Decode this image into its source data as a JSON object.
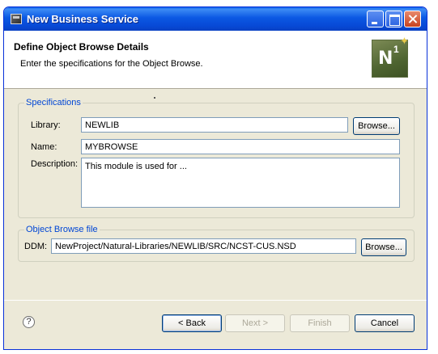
{
  "window": {
    "title": "New Business Service"
  },
  "header": {
    "title": "Define Object Browse Details",
    "description": "Enter the specifications for the Object Browse.",
    "logo_text_n": "N",
    "logo_text_1": "1"
  },
  "specifications": {
    "legend": "Specifications",
    "library_label": "Library:",
    "library_value": "NEWLIB",
    "browse_label": "Browse...",
    "name_label": "Name:",
    "name_value": "MYBROWSE",
    "description_label": "Description:",
    "description_value": "This module is used for ..."
  },
  "object_browse_file": {
    "legend": "Object Browse file",
    "ddm_label": "DDM:",
    "ddm_value": "NewProject/Natural-Libraries/NEWLIB/SRC/NCST-CUS.NSD",
    "browse_label": "Browse..."
  },
  "footer": {
    "help_glyph": "?",
    "back_label": "< Back",
    "next_label": "Next >",
    "finish_label": "Finish",
    "cancel_label": "Cancel"
  }
}
